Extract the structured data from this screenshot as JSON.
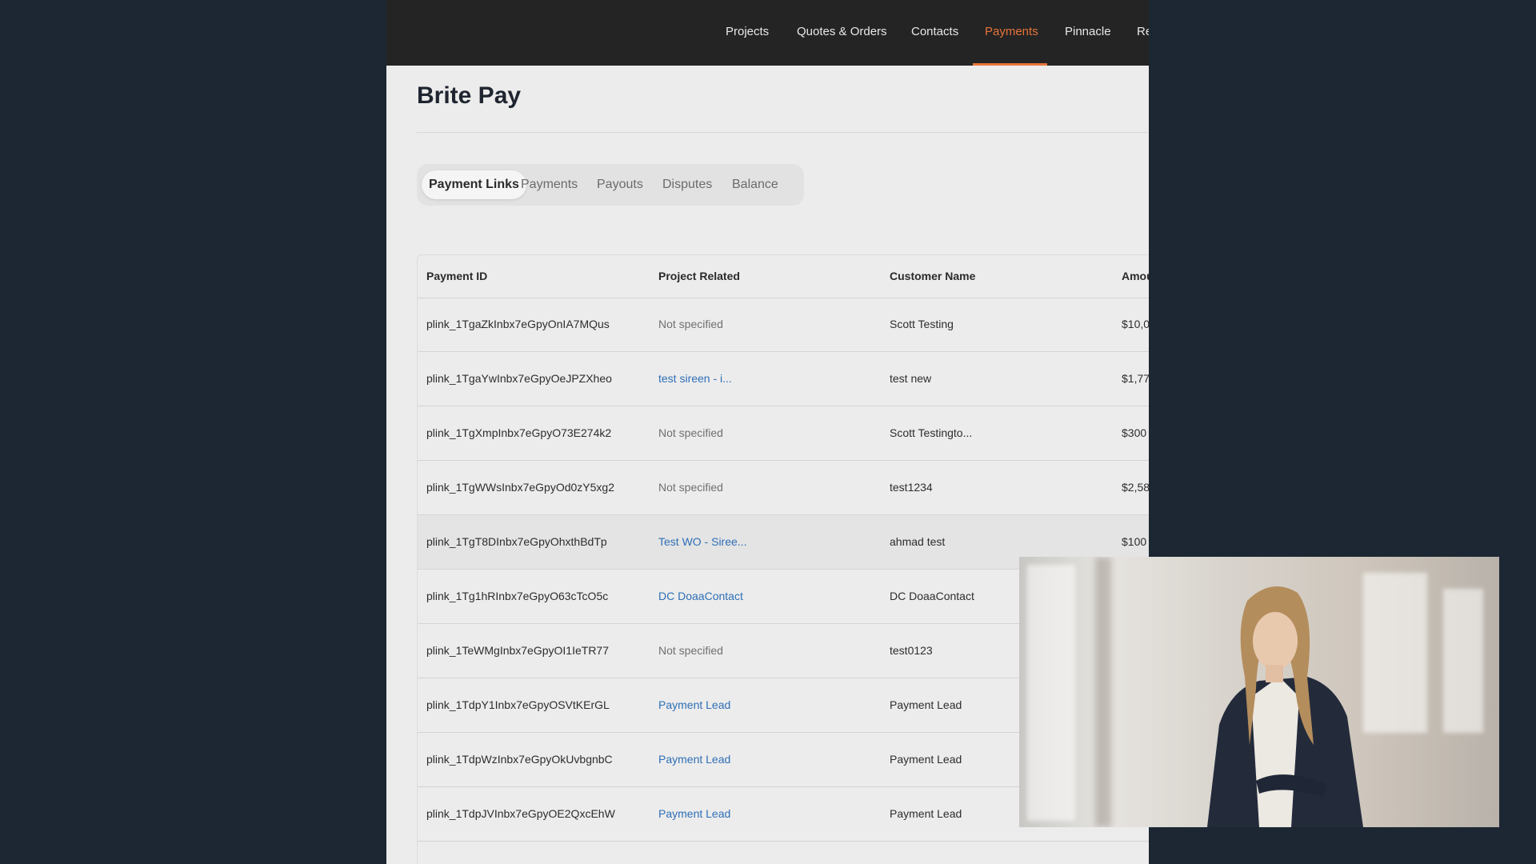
{
  "nav": {
    "items": [
      {
        "label": "Projects",
        "active": false
      },
      {
        "label": "Quotes & Orders",
        "active": false
      },
      {
        "label": "Contacts",
        "active": false
      },
      {
        "label": "Payments",
        "active": true
      },
      {
        "label": "Pinnacle",
        "active": false
      },
      {
        "label": "Re",
        "active": false
      }
    ],
    "active_color": "#e8743a"
  },
  "page": {
    "title": "Brite Pay"
  },
  "tabs": [
    {
      "label": "Payment Links",
      "active": true
    },
    {
      "label": "Payments",
      "active": false
    },
    {
      "label": "Payouts",
      "active": false
    },
    {
      "label": "Disputes",
      "active": false
    },
    {
      "label": "Balance",
      "active": false
    }
  ],
  "table": {
    "columns": [
      "Payment ID",
      "Project Related",
      "Customer Name",
      "Amou"
    ],
    "rows": [
      {
        "id": "plink_1TgaZkInbx7eGpyOnIA7MQus",
        "project": "Not specified",
        "project_link": false,
        "customer": "Scott Testing",
        "amount": "$10,0"
      },
      {
        "id": "plink_1TgaYwInbx7eGpyOeJPZXheo",
        "project": "test sireen - i...",
        "project_link": true,
        "customer": "test new",
        "amount": "$1,77"
      },
      {
        "id": "plink_1TgXmpInbx7eGpyO73E274k2",
        "project": "Not specified",
        "project_link": false,
        "customer": "Scott Testingto...",
        "amount": "$300"
      },
      {
        "id": "plink_1TgWWsInbx7eGpyOd0zY5xg2",
        "project": "Not specified",
        "project_link": false,
        "customer": "test1234",
        "amount": "$2,58"
      },
      {
        "id": "plink_1TgT8DInbx7eGpyOhxthBdTp",
        "project": "Test WO - Siree...",
        "project_link": true,
        "customer": "ahmad test",
        "amount": "$100"
      },
      {
        "id": "plink_1Tg1hRInbx7eGpyO63cTcO5c",
        "project": "DC DoaaContact",
        "project_link": true,
        "customer": "DC DoaaContact",
        "amount": ""
      },
      {
        "id": "plink_1TeWMgInbx7eGpyOI1IeTR77",
        "project": "Not specified",
        "project_link": false,
        "customer": "test0123",
        "amount": ""
      },
      {
        "id": "plink_1TdpY1Inbx7eGpyOSVtKErGL",
        "project": "Payment Lead",
        "project_link": true,
        "customer": "Payment Lead",
        "amount": ""
      },
      {
        "id": "plink_1TdpWzInbx7eGpyOkUvbgnbC",
        "project": "Payment Lead",
        "project_link": true,
        "customer": "Payment Lead",
        "amount": ""
      },
      {
        "id": "plink_1TdpJVInbx7eGpyOE2QxcEhW",
        "project": "Payment Lead",
        "project_link": true,
        "customer": "Payment Lead",
        "amount": ""
      }
    ]
  },
  "colors": {
    "background": "#1c2733",
    "link": "#2e6fb6",
    "topbar": "#242424"
  }
}
